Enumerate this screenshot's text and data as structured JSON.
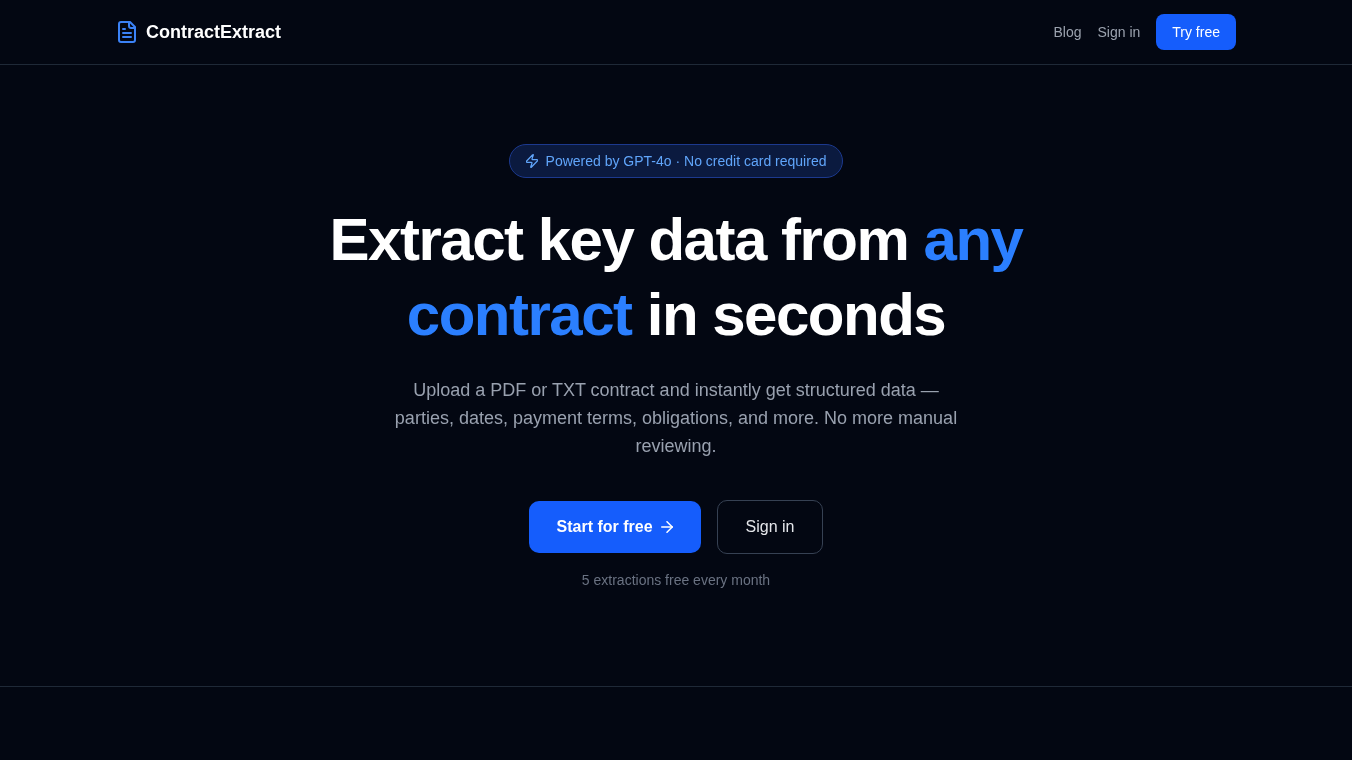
{
  "nav": {
    "logo": "ContractExtract",
    "links": [
      "Blog",
      "Sign in"
    ],
    "cta": "Try free"
  },
  "hero": {
    "badge": "Powered by GPT-4o · No credit card required",
    "headline": [
      {
        "text": "Extract key data from ",
        "highlight": false
      },
      {
        "text": "any contract",
        "highlight": true
      },
      {
        "text": " in seconds",
        "highlight": false
      }
    ],
    "description": "Upload a PDF or TXT contract and instantly get structured data — parties, dates, payment terms, obligations, and more. No more manual reviewing.",
    "primary_button": "Start for free",
    "secondary_button": "Sign in",
    "note": "5 extractions free every month"
  }
}
